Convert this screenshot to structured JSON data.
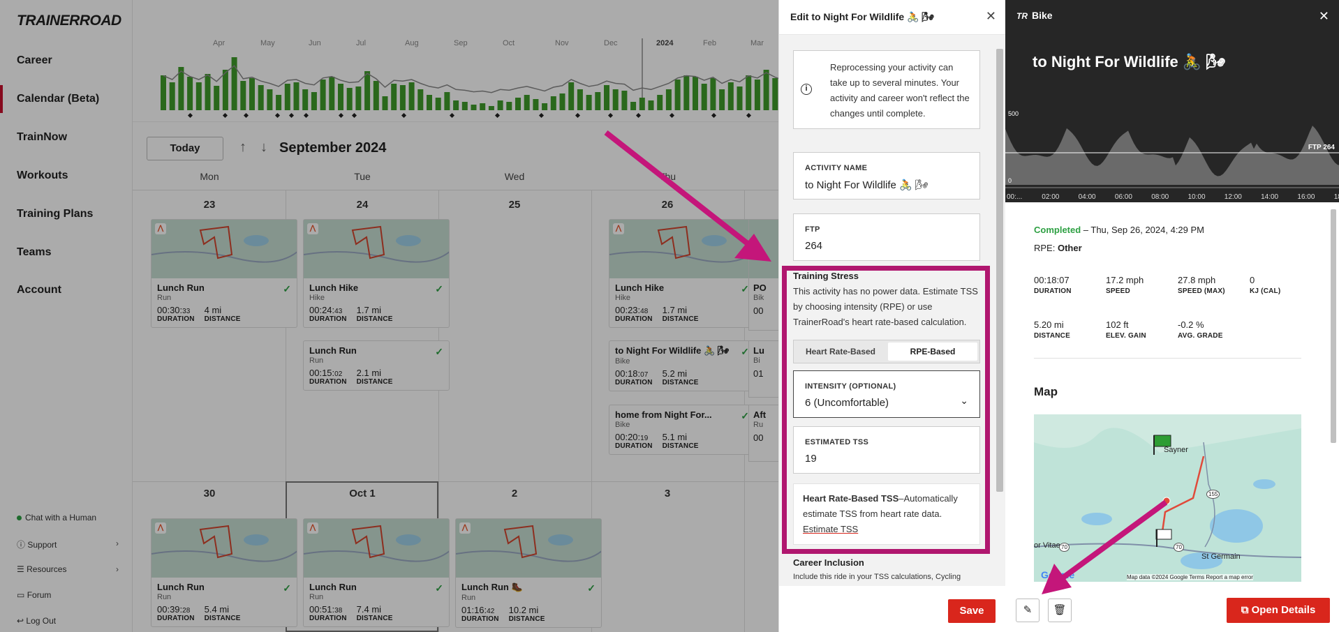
{
  "sidebar": {
    "logo": "TRAINERROAD",
    "items": [
      "Career",
      "Calendar (Beta)",
      "TrainNow",
      "Workouts",
      "Training Plans",
      "Teams",
      "Account"
    ],
    "active": "Calendar (Beta)",
    "bottom": [
      "Chat with a Human",
      "Support",
      "Resources",
      "Forum",
      "Log Out"
    ]
  },
  "trend": {
    "months": [
      "Apr",
      "May",
      "Jun",
      "Jul",
      "Aug",
      "Sep",
      "Oct",
      "Nov",
      "Dec",
      "2024",
      "Feb",
      "Mar"
    ]
  },
  "calendar": {
    "today_label": "Today",
    "up_arrow": "↑",
    "down_arrow": "↓",
    "month_title": "September 2024",
    "weekdays": [
      "Mon",
      "Tue",
      "Wed",
      "Thu"
    ],
    "week1_days": [
      "23",
      "24",
      "25",
      "26"
    ],
    "week2_days": [
      "30",
      "Oct 1",
      "2",
      "3"
    ],
    "cards": [
      {
        "title": "Lunch Run",
        "type": "Run",
        "duration_main": "00:30:",
        "duration_sec": "33",
        "distance": "4 mi"
      },
      {
        "title": "Lunch Hike",
        "type": "Hike",
        "duration_main": "00:24:",
        "duration_sec": "43",
        "distance": "1.7 mi"
      },
      {
        "title": "Lunch Run",
        "type": "Run",
        "duration_main": "00:15:",
        "duration_sec": "02",
        "distance": "2.1 mi"
      },
      {
        "title": "Lunch Hike",
        "type": "Hike",
        "duration_main": "00:23:",
        "duration_sec": "48",
        "distance": "1.7 mi"
      },
      {
        "title": "to Night For Wildlife 🚴 🌬",
        "type": "Bike",
        "duration_main": "00:18:",
        "duration_sec": "07",
        "distance": "5.2 mi"
      },
      {
        "title": "home from Night For...",
        "type": "Bike",
        "duration_main": "00:20:",
        "duration_sec": "19",
        "distance": "5.1 mi"
      },
      {
        "title": "Lunch Run",
        "type": "Run",
        "duration_main": "00:39:",
        "duration_sec": "28",
        "distance": "5.4 mi"
      },
      {
        "title": "Lunch Run",
        "type": "Run",
        "duration_main": "00:51:",
        "duration_sec": "38",
        "distance": "7.4 mi"
      },
      {
        "title": "Lunch Run 🥾",
        "type": "Run",
        "duration_main": "01:16:",
        "duration_sec": "42",
        "distance": "10.2 mi"
      }
    ],
    "dur_label": "DURATION",
    "dist_label": "DISTANCE",
    "partial": [
      "PO",
      "Bik",
      "00",
      "Lu",
      "Bi",
      "01",
      "Aft",
      "Ru",
      "00"
    ]
  },
  "edit_panel": {
    "title": "Edit to Night For Wildlife 🚴 🌬",
    "info": "Reprocessing your activity can take up to several minutes. Your activity and career won't reflect the changes until complete.",
    "activity_name_label": "ACTIVITY NAME",
    "activity_name_value": "to Night For Wildlife 🚴 🌬",
    "ftp_label": "FTP",
    "ftp_value": "264",
    "training_stress_heading": "Training Stress",
    "training_stress_desc": "This activity has no power data. Estimate TSS by choosing intensity (RPE) or use TrainerRoad's heart rate-based calculation.",
    "seg_left": "Heart Rate-Based",
    "seg_right": "RPE-Based",
    "intensity_label": "INTENSITY (OPTIONAL)",
    "intensity_value": "6 (Uncomfortable)",
    "est_tss_label": "ESTIMATED TSS",
    "est_tss_value": "19",
    "hr_tss_bold": "Heart Rate-Based TSS",
    "hr_tss_rest": "–Automatically estimate TSS from heart rate data.",
    "hr_tss_link": "Estimate TSS",
    "career_heading": "Career Inclusion",
    "career_desc": "Include this ride in your TSS calculations, Cycling",
    "save_label": "Save"
  },
  "bike_panel": {
    "header": "Bike",
    "title": "to Night For Wildlife 🚴 🌬",
    "chart_top_label": "500",
    "chart_zero_label": "0",
    "ftp_line_label": "FTP 264",
    "time_ticks": [
      "00:...",
      "02:00",
      "04:00",
      "06:00",
      "08:00",
      "10:00",
      "12:00",
      "14:00",
      "16:00",
      "18:00"
    ],
    "status": "Completed",
    "date": " – Thu, Sep 26, 2024, 4:29 PM",
    "rpe_label": "RPE: ",
    "rpe_value": "Other",
    "stats_row1": [
      {
        "v": "00:18:07",
        "l": "DURATION"
      },
      {
        "v": "17.2 mph",
        "l": "SPEED"
      },
      {
        "v": "27.8 mph",
        "l": "SPEED (MAX)"
      },
      {
        "v": "0",
        "l": "KJ (CAL)"
      }
    ],
    "stats_row2": [
      {
        "v": "5.20 mi",
        "l": "DISTANCE"
      },
      {
        "v": "102 ft",
        "l": "ELEV. GAIN"
      },
      {
        "v": "-0.2 %",
        "l": "AVG. GRADE"
      }
    ],
    "map_heading": "Map",
    "map_labels": {
      "sayner": "Sayner",
      "vitae": "or Vitae",
      "stgermain": "St Germain",
      "r155": "155",
      "r70a": "70",
      "r70b": "70",
      "google": "Google",
      "footer": "Map data ©2024 Google   Terms   Report a map error"
    },
    "open_details": "Open Details"
  },
  "colors": {
    "accent": "#d9261c",
    "highlight": "#b0176f",
    "bar_green": "#3f9b2b",
    "completed": "#2ea043"
  }
}
